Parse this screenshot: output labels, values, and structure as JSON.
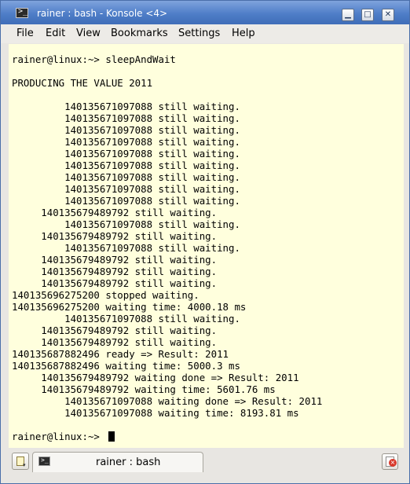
{
  "window": {
    "title": "rainer : bash - Konsole <4>",
    "app_icon_glyph": ">_",
    "minimize_glyph": "▁",
    "maximize_glyph": "□",
    "close_glyph": "✕"
  },
  "menu": {
    "items": [
      "File",
      "Edit",
      "View",
      "Bookmarks",
      "Settings",
      "Help"
    ]
  },
  "terminal": {
    "lines": [
      "",
      "rainer@linux:~> sleepAndWait",
      "",
      "PRODUCING THE VALUE 2011",
      "",
      "         140135671097088 still waiting.",
      "         140135671097088 still waiting.",
      "         140135671097088 still waiting.",
      "         140135671097088 still waiting.",
      "         140135671097088 still waiting.",
      "         140135671097088 still waiting.",
      "         140135671097088 still waiting.",
      "         140135671097088 still waiting.",
      "         140135671097088 still waiting.",
      "     140135679489792 still waiting.",
      "         140135671097088 still waiting.",
      "     140135679489792 still waiting.",
      "         140135671097088 still waiting.",
      "     140135679489792 still waiting.",
      "     140135679489792 still waiting.",
      "     140135679489792 still waiting.",
      "140135696275200 stopped waiting.",
      "140135696275200 waiting time: 4000.18 ms",
      "         140135671097088 still waiting.",
      "     140135679489792 still waiting.",
      "     140135679489792 still waiting.",
      "140135687882496 ready => Result: 2011",
      "140135687882496 waiting time: 5000.3 ms",
      "     140135679489792 waiting done => Result: 2011",
      "     140135679489792 waiting time: 5601.76 ms",
      "         140135671097088 waiting done => Result: 2011",
      "         140135671097088 waiting time: 8193.81 ms",
      "",
      "rainer@linux:~> "
    ]
  },
  "tabs": {
    "items": [
      {
        "label": "rainer : bash",
        "icon_glyph": ">_"
      }
    ],
    "new_tab_arrow": "▾",
    "close_tab_glyph": "×"
  },
  "colors": {
    "terminal_background": "#ffffdd",
    "terminal_text": "#000000",
    "titlebar": "#4f7ec8"
  },
  "icons": {
    "app": "konsole-terminal-icon",
    "new_tab": "new-tab-icon",
    "close_tab": "close-tab-icon"
  }
}
